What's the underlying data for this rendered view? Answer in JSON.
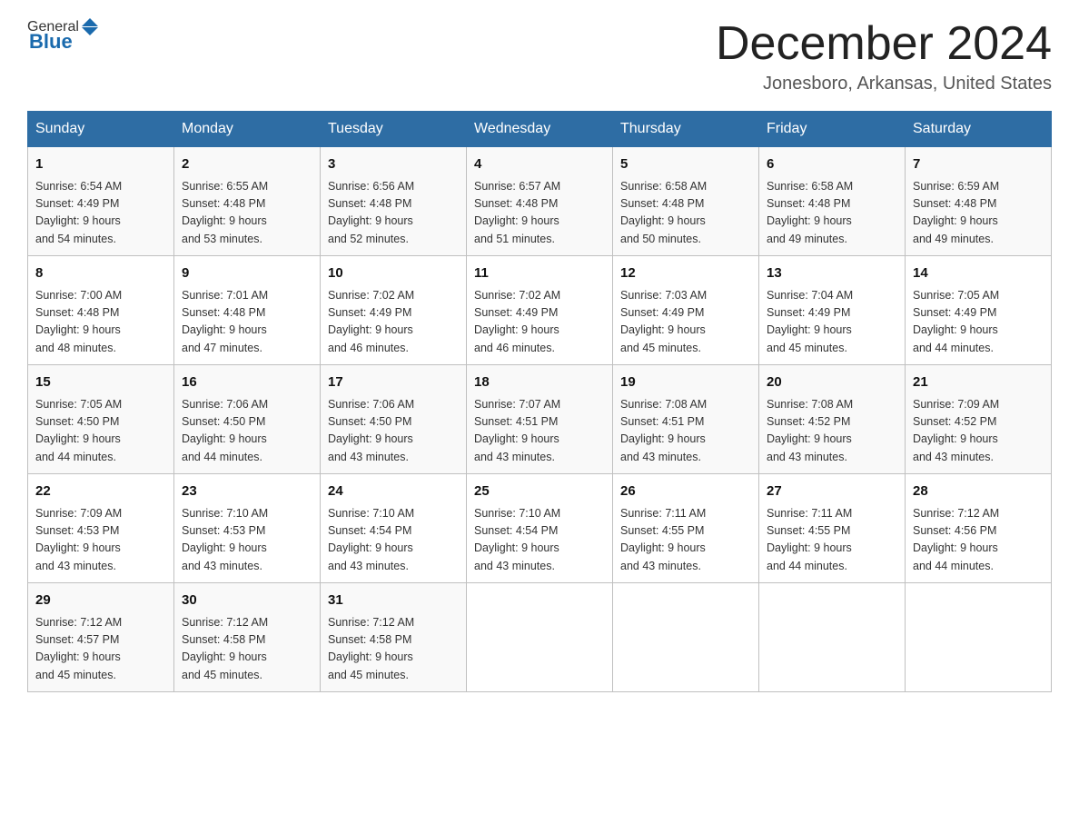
{
  "header": {
    "logo_general": "General",
    "logo_blue": "Blue",
    "title": "December 2024",
    "subtitle": "Jonesboro, Arkansas, United States"
  },
  "weekdays": [
    "Sunday",
    "Monday",
    "Tuesday",
    "Wednesday",
    "Thursday",
    "Friday",
    "Saturday"
  ],
  "weeks": [
    [
      {
        "day": "1",
        "sunrise": "6:54 AM",
        "sunset": "4:49 PM",
        "daylight": "9 hours and 54 minutes."
      },
      {
        "day": "2",
        "sunrise": "6:55 AM",
        "sunset": "4:48 PM",
        "daylight": "9 hours and 53 minutes."
      },
      {
        "day": "3",
        "sunrise": "6:56 AM",
        "sunset": "4:48 PM",
        "daylight": "9 hours and 52 minutes."
      },
      {
        "day": "4",
        "sunrise": "6:57 AM",
        "sunset": "4:48 PM",
        "daylight": "9 hours and 51 minutes."
      },
      {
        "day": "5",
        "sunrise": "6:58 AM",
        "sunset": "4:48 PM",
        "daylight": "9 hours and 50 minutes."
      },
      {
        "day": "6",
        "sunrise": "6:58 AM",
        "sunset": "4:48 PM",
        "daylight": "9 hours and 49 minutes."
      },
      {
        "day": "7",
        "sunrise": "6:59 AM",
        "sunset": "4:48 PM",
        "daylight": "9 hours and 49 minutes."
      }
    ],
    [
      {
        "day": "8",
        "sunrise": "7:00 AM",
        "sunset": "4:48 PM",
        "daylight": "9 hours and 48 minutes."
      },
      {
        "day": "9",
        "sunrise": "7:01 AM",
        "sunset": "4:48 PM",
        "daylight": "9 hours and 47 minutes."
      },
      {
        "day": "10",
        "sunrise": "7:02 AM",
        "sunset": "4:49 PM",
        "daylight": "9 hours and 46 minutes."
      },
      {
        "day": "11",
        "sunrise": "7:02 AM",
        "sunset": "4:49 PM",
        "daylight": "9 hours and 46 minutes."
      },
      {
        "day": "12",
        "sunrise": "7:03 AM",
        "sunset": "4:49 PM",
        "daylight": "9 hours and 45 minutes."
      },
      {
        "day": "13",
        "sunrise": "7:04 AM",
        "sunset": "4:49 PM",
        "daylight": "9 hours and 45 minutes."
      },
      {
        "day": "14",
        "sunrise": "7:05 AM",
        "sunset": "4:49 PM",
        "daylight": "9 hours and 44 minutes."
      }
    ],
    [
      {
        "day": "15",
        "sunrise": "7:05 AM",
        "sunset": "4:50 PM",
        "daylight": "9 hours and 44 minutes."
      },
      {
        "day": "16",
        "sunrise": "7:06 AM",
        "sunset": "4:50 PM",
        "daylight": "9 hours and 44 minutes."
      },
      {
        "day": "17",
        "sunrise": "7:06 AM",
        "sunset": "4:50 PM",
        "daylight": "9 hours and 43 minutes."
      },
      {
        "day": "18",
        "sunrise": "7:07 AM",
        "sunset": "4:51 PM",
        "daylight": "9 hours and 43 minutes."
      },
      {
        "day": "19",
        "sunrise": "7:08 AM",
        "sunset": "4:51 PM",
        "daylight": "9 hours and 43 minutes."
      },
      {
        "day": "20",
        "sunrise": "7:08 AM",
        "sunset": "4:52 PM",
        "daylight": "9 hours and 43 minutes."
      },
      {
        "day": "21",
        "sunrise": "7:09 AM",
        "sunset": "4:52 PM",
        "daylight": "9 hours and 43 minutes."
      }
    ],
    [
      {
        "day": "22",
        "sunrise": "7:09 AM",
        "sunset": "4:53 PM",
        "daylight": "9 hours and 43 minutes."
      },
      {
        "day": "23",
        "sunrise": "7:10 AM",
        "sunset": "4:53 PM",
        "daylight": "9 hours and 43 minutes."
      },
      {
        "day": "24",
        "sunrise": "7:10 AM",
        "sunset": "4:54 PM",
        "daylight": "9 hours and 43 minutes."
      },
      {
        "day": "25",
        "sunrise": "7:10 AM",
        "sunset": "4:54 PM",
        "daylight": "9 hours and 43 minutes."
      },
      {
        "day": "26",
        "sunrise": "7:11 AM",
        "sunset": "4:55 PM",
        "daylight": "9 hours and 43 minutes."
      },
      {
        "day": "27",
        "sunrise": "7:11 AM",
        "sunset": "4:55 PM",
        "daylight": "9 hours and 44 minutes."
      },
      {
        "day": "28",
        "sunrise": "7:12 AM",
        "sunset": "4:56 PM",
        "daylight": "9 hours and 44 minutes."
      }
    ],
    [
      {
        "day": "29",
        "sunrise": "7:12 AM",
        "sunset": "4:57 PM",
        "daylight": "9 hours and 45 minutes."
      },
      {
        "day": "30",
        "sunrise": "7:12 AM",
        "sunset": "4:58 PM",
        "daylight": "9 hours and 45 minutes."
      },
      {
        "day": "31",
        "sunrise": "7:12 AM",
        "sunset": "4:58 PM",
        "daylight": "9 hours and 45 minutes."
      },
      null,
      null,
      null,
      null
    ]
  ],
  "labels": {
    "sunrise": "Sunrise: ",
    "sunset": "Sunset: ",
    "daylight": "Daylight: "
  }
}
